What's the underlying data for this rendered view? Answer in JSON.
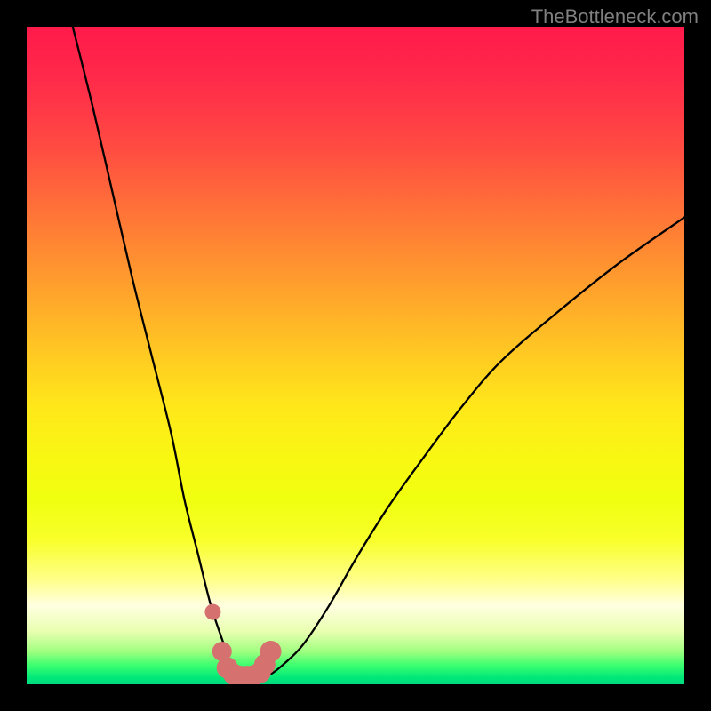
{
  "watermark": "TheBottleneck.com",
  "colors": {
    "frame": "#000000",
    "curve": "#000000",
    "markers": "#d5716e",
    "gradient_top": "#ff1a4a",
    "gradient_bottom": "#00d880"
  },
  "chart_data": {
    "type": "line",
    "title": "",
    "xlabel": "",
    "ylabel": "",
    "xlim": [
      0,
      100
    ],
    "ylim": [
      0,
      100
    ],
    "grid": false,
    "series": [
      {
        "name": "bottleneck-curve",
        "x": [
          7,
          10,
          13,
          16,
          19,
          22,
          24,
          26,
          28,
          30,
          31,
          32,
          33,
          35,
          37,
          39,
          42,
          46,
          50,
          55,
          60,
          66,
          72,
          80,
          90,
          100
        ],
        "y": [
          100,
          88,
          75,
          62,
          50,
          38,
          28,
          20,
          12,
          6,
          3,
          1.5,
          1,
          1,
          1.5,
          3,
          6,
          12,
          19,
          27,
          34,
          42,
          49,
          56,
          64,
          71
        ]
      }
    ],
    "markers": {
      "x": [
        28.3,
        29.7,
        30.5,
        31.5,
        32.5,
        33.5,
        34.5,
        35.5,
        36.2,
        37.1
      ],
      "y": [
        11,
        5,
        2.5,
        1.5,
        1.2,
        1.2,
        1.3,
        1.8,
        3,
        5
      ],
      "radius": [
        9,
        11,
        12,
        12,
        12,
        12,
        12,
        12,
        12,
        12
      ],
      "color": "#d5716e"
    }
  }
}
